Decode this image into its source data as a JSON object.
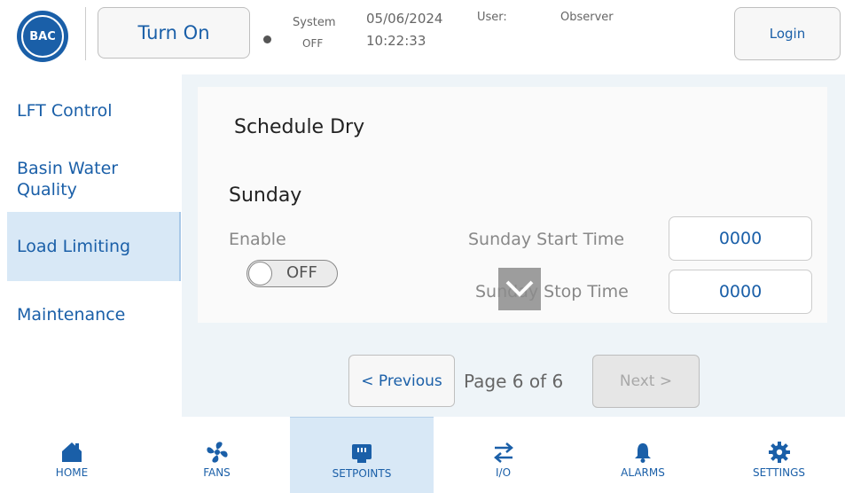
{
  "header": {
    "logo_text": "BAC",
    "turn_on_label": "Turn On",
    "system_label": "System",
    "system_status": "OFF",
    "date": "05/06/2024",
    "time": "10:22:33",
    "user_label": "User:",
    "user_value": "Observer",
    "login_label": "Login"
  },
  "sidebar": {
    "items": [
      {
        "label": "LFT Control"
      },
      {
        "label": "Basin Water Quality"
      },
      {
        "label": "Load Limiting",
        "active": true
      },
      {
        "label": "Maintenance"
      }
    ]
  },
  "main": {
    "title": "Schedule Dry",
    "day": "Sunday",
    "enable_label": "Enable",
    "toggle_state": "OFF",
    "start_label": "Sunday Start Time",
    "start_value": "0000",
    "stop_label": "Sunday Stop Time",
    "stop_value": "0000"
  },
  "pager": {
    "prev_label": "< Previous",
    "page_text": "Page 6 of 6",
    "next_label": "Next >"
  },
  "bottom_nav": {
    "items": [
      {
        "label": "HOME",
        "icon": "home-icon"
      },
      {
        "label": "FANS",
        "icon": "fan-icon"
      },
      {
        "label": "SETPOINTS",
        "icon": "setpoints-icon",
        "active": true
      },
      {
        "label": "I/O",
        "icon": "io-arrows-icon"
      },
      {
        "label": "ALARMS",
        "icon": "bell-icon"
      },
      {
        "label": "SETTINGS",
        "icon": "gear-icon"
      }
    ]
  },
  "colors": {
    "accent": "#1a5fa8",
    "active_bg": "#d8e8f6",
    "content_bg": "#eef4f8"
  }
}
